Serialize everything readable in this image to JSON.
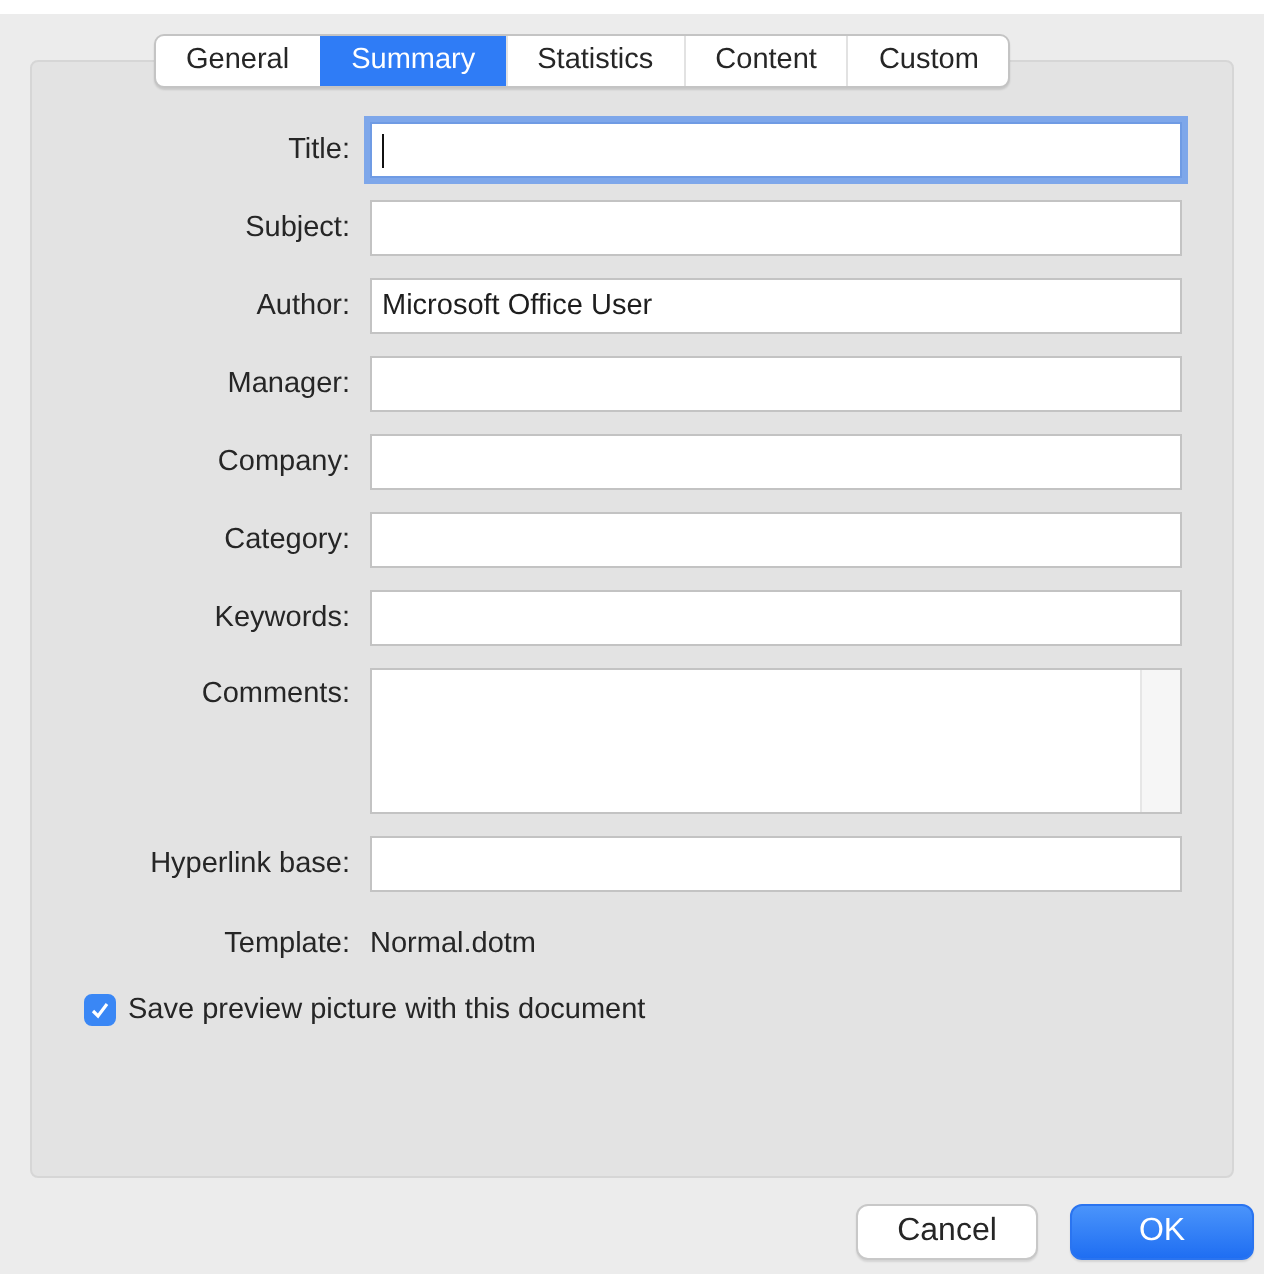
{
  "tabs": [
    {
      "label": "General",
      "selected": false
    },
    {
      "label": "Summary",
      "selected": true
    },
    {
      "label": "Statistics",
      "selected": false
    },
    {
      "label": "Content",
      "selected": false
    },
    {
      "label": "Custom",
      "selected": false
    }
  ],
  "fields": [
    {
      "kind": "text",
      "label": "Title:",
      "focused": true
    },
    {
      "kind": "text",
      "label": "Subject:",
      "focused": false
    },
    {
      "kind": "text",
      "label": "Author:",
      "value": "Microsoft Office User",
      "focused": false
    },
    {
      "kind": "text",
      "label": "Manager:",
      "focused": false
    },
    {
      "kind": "text",
      "label": "Company:",
      "focused": false
    },
    {
      "kind": "text",
      "label": "Category:",
      "focused": false
    },
    {
      "kind": "text",
      "label": "Keywords:",
      "focused": false
    },
    {
      "kind": "textarea",
      "label": "Comments:",
      "focused": false
    },
    {
      "kind": "text",
      "label": "Hyperlink base:",
      "focused": false
    },
    {
      "kind": "info",
      "label": "Template:",
      "value": "Normal.dotm"
    }
  ],
  "save_preview": {
    "label": "Save preview picture with this document",
    "checked": true
  },
  "buttons": [
    {
      "label": "Cancel",
      "default": false
    },
    {
      "label": "OK",
      "default": true
    }
  ]
}
